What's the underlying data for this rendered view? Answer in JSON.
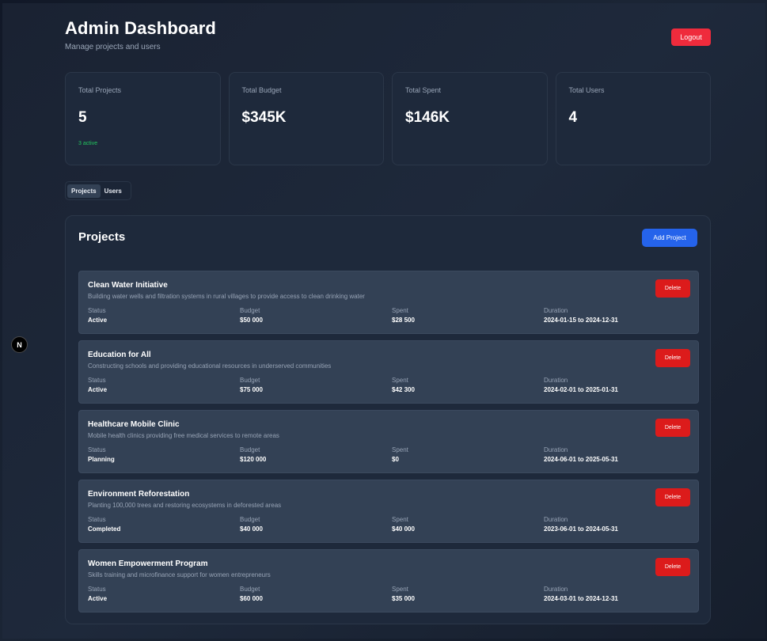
{
  "header": {
    "title": "Admin Dashboard",
    "subtitle": "Manage projects and users",
    "logout_label": "Logout"
  },
  "stats": [
    {
      "label": "Total Projects",
      "value": "5",
      "sub": "3 active"
    },
    {
      "label": "Total Budget",
      "value": "$345K",
      "sub": ""
    },
    {
      "label": "Total Spent",
      "value": "$146K",
      "sub": ""
    },
    {
      "label": "Total Users",
      "value": "4",
      "sub": ""
    }
  ],
  "tabs": [
    {
      "label": "Projects",
      "active": true
    },
    {
      "label": "Users",
      "active": false
    }
  ],
  "projects_panel": {
    "title": "Projects",
    "add_label": "Add Project",
    "field_labels": {
      "status": "Status",
      "budget": "Budget",
      "spent": "Spent",
      "duration": "Duration"
    },
    "delete_label": "Delete",
    "items": [
      {
        "name": "Clean Water Initiative",
        "description": "Building water wells and filtration systems in rural villages to provide access to clean drinking water",
        "status": "Active",
        "budget": "$50 000",
        "spent": "$28 500",
        "duration": "2024-01-15 to 2024-12-31"
      },
      {
        "name": "Education for All",
        "description": "Constructing schools and providing educational resources in underserved communities",
        "status": "Active",
        "budget": "$75 000",
        "spent": "$42 300",
        "duration": "2024-02-01 to 2025-01-31"
      },
      {
        "name": "Healthcare Mobile Clinic",
        "description": "Mobile health clinics providing free medical services to remote areas",
        "status": "Planning",
        "budget": "$120 000",
        "spent": "$0",
        "duration": "2024-06-01 to 2025-05-31"
      },
      {
        "name": "Environment Reforestation",
        "description": "Planting 100,000 trees and restoring ecosystems in deforested areas",
        "status": "Completed",
        "budget": "$40 000",
        "spent": "$40 000",
        "duration": "2023-06-01 to 2024-05-31"
      },
      {
        "name": "Women Empowerment Program",
        "description": "Skills training and microfinance support for women entrepreneurs",
        "status": "Active",
        "budget": "$60 000",
        "spent": "$35 000",
        "duration": "2024-03-01 to 2024-12-31"
      }
    ]
  },
  "dev_badge": {
    "label": "N",
    "icon": "nextjs-icon"
  },
  "colors": {
    "accent": "#2563eb",
    "danger": "#dc1b1b",
    "success": "#22c55e",
    "card": "#1e293b",
    "row": "#334155"
  }
}
